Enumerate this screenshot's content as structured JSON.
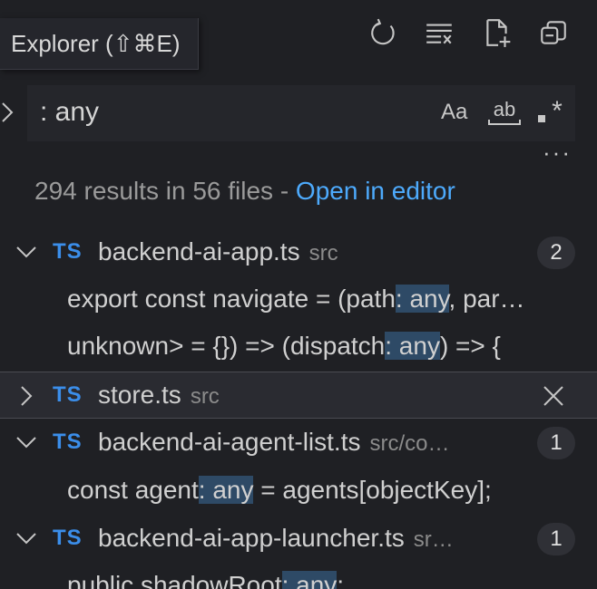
{
  "tooltip": {
    "label": "Explorer (⇧⌘E)"
  },
  "toolbar": {
    "icons": [
      "refresh-icon",
      "clear-results-icon",
      "new-search-editor-icon",
      "collapse-all-icon"
    ]
  },
  "search": {
    "value": ": any",
    "options": {
      "match_case": "Aa",
      "whole_word": "ab",
      "regex": "*"
    }
  },
  "more_label": "···",
  "summary": {
    "text": "294 results in 56 files - ",
    "link": "Open in editor"
  },
  "results": [
    {
      "kind": "file",
      "lang": "TS",
      "name": "backend-ai-app.ts",
      "dir": "src",
      "count": "2",
      "expanded": true
    },
    {
      "kind": "match",
      "before": "export const navigate = (path",
      "hit": ": any",
      "after": ", par…"
    },
    {
      "kind": "match",
      "before": "unknown> = {}) => (dispatch",
      "hit": ": any",
      "after": ") => {"
    },
    {
      "kind": "file",
      "lang": "TS",
      "name": "store.ts",
      "dir": "src",
      "expanded": false,
      "selected": true
    },
    {
      "kind": "file",
      "lang": "TS",
      "name": "backend-ai-agent-list.ts",
      "dir": "src/co…",
      "count": "1",
      "expanded": true
    },
    {
      "kind": "match",
      "before": "const agent",
      "hit": ": any",
      "after": " = agents[objectKey];"
    },
    {
      "kind": "file",
      "lang": "TS",
      "name": "backend-ai-app-launcher.ts",
      "dir": "sr…",
      "count": "1",
      "expanded": true
    },
    {
      "kind": "match",
      "before": "public shadowRoot",
      "hit": ": any",
      "after": ";"
    }
  ],
  "colors": {
    "background": "#1f2024",
    "link": "#4daafc",
    "ts_label": "#3b8eea",
    "highlight": "#2e4a66"
  }
}
